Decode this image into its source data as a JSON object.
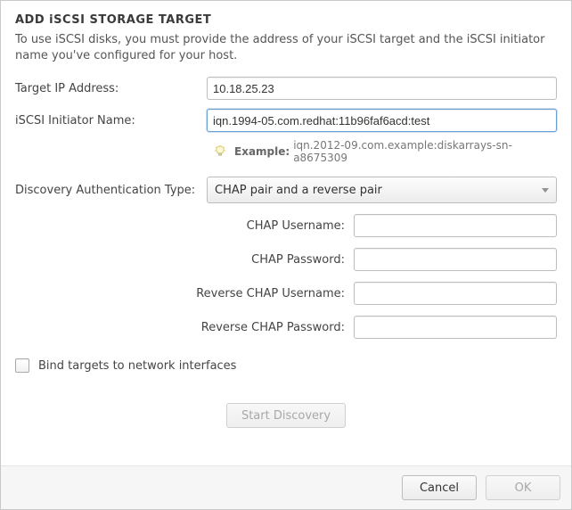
{
  "title": "ADD iSCSI STORAGE TARGET",
  "subtitle": "To use iSCSI disks, you must provide the address of your iSCSI target and the iSCSI initiator name you've configured for your host.",
  "target_ip": {
    "label": "Target IP Address:",
    "value": "10.18.25.23"
  },
  "initiator": {
    "label": "iSCSI Initiator Name:",
    "value": "iqn.1994-05.com.redhat:11b96faf6acd:test",
    "example_label": "Example:",
    "example_value": "iqn.2012-09.com.example:diskarrays-sn-a8675309"
  },
  "auth_type": {
    "label": "Discovery Authentication Type:",
    "selected": "CHAP pair and a reverse pair"
  },
  "chap": {
    "user_label": "CHAP Username:",
    "user_value": "",
    "pass_label": "CHAP Password:",
    "pass_value": "",
    "rev_user_label": "Reverse CHAP Username:",
    "rev_user_value": "",
    "rev_pass_label": "Reverse CHAP Password:",
    "rev_pass_value": ""
  },
  "bind_targets_label": "Bind targets to network interfaces",
  "bind_targets_checked": false,
  "buttons": {
    "start_discovery": "Start Discovery",
    "cancel": "Cancel",
    "ok": "OK"
  }
}
